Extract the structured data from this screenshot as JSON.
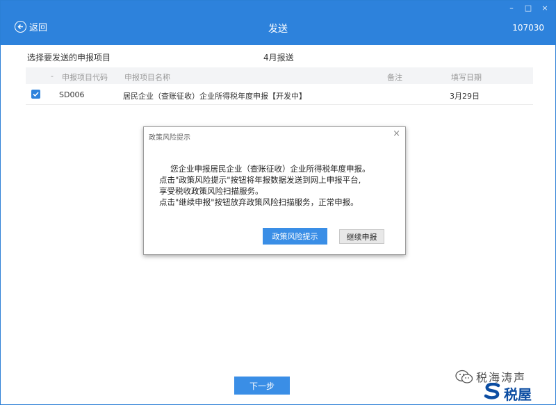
{
  "window": {
    "title": "发送",
    "code": "107030",
    "back_label": "返回",
    "controls": {
      "minimize": "–",
      "maximize": "□",
      "close": "×"
    }
  },
  "header": {
    "section_label": "选择要发送的申报项目",
    "month_label": "4月报送"
  },
  "table": {
    "columns": {
      "marker": "-",
      "code": "申报项目代码",
      "name": "申报项目名称",
      "note": "备注",
      "date": "填写日期"
    },
    "rows": [
      {
        "checked": true,
        "code": "SD006",
        "name": "居民企业（查账征收）企业所得税年度申报【开发中】",
        "note": "",
        "date": "3月29日"
      }
    ]
  },
  "dialog": {
    "title": "政策风险提示",
    "close": "×",
    "line1": "您企业申报居民企业（查账征收）企业所得税年度申报。",
    "line2": "点击\"政策风险提示\"按钮将年报数据发送到网上申报平台,",
    "line3": "享受税收政策风险扫描服务。",
    "line4": "点击\"继续申报\"按钮放弃政策风险扫描服务，正常申报。",
    "primary_button": "政策风险提示",
    "secondary_button": "继续申报"
  },
  "footer": {
    "next_button": "下一步"
  },
  "watermark": {
    "text1": "税海涛声",
    "text2": "税屋"
  },
  "colors": {
    "brand_blue": "#2d82dc",
    "button_blue": "#3a8ee6"
  }
}
